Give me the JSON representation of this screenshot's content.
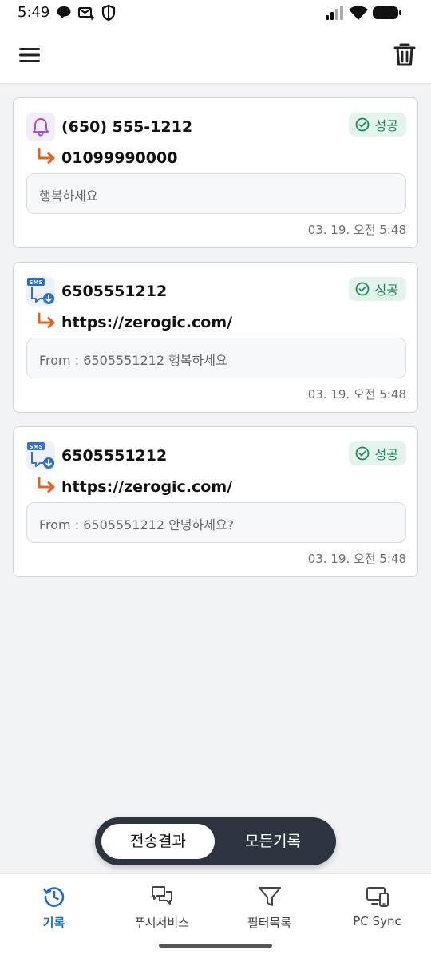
{
  "status_bar": {
    "time": "5:49"
  },
  "colors": {
    "accent": "#1c6fc4",
    "success": "#1f8a5b",
    "success_bg": "#e3f4ec",
    "arrow": "#e3601e",
    "segment_bg": "#2d333f"
  },
  "records": [
    {
      "icon": "bell-icon",
      "sender": "(650) 555-1212",
      "status": "성공",
      "target": "01099990000",
      "message": "행복하세요",
      "date": "03. 19. 오전 5:48"
    },
    {
      "icon": "sms-icon",
      "sender": "6505551212",
      "status": "성공",
      "target": "https://zerogic.com/",
      "message": "From : 6505551212 행복하세요",
      "date": "03. 19. 오전 5:48"
    },
    {
      "icon": "sms-icon",
      "sender": "6505551212",
      "status": "성공",
      "target": "https://zerogic.com/",
      "message": "From : 6505551212 안녕하세요?",
      "date": "03. 19. 오전 5:48"
    }
  ],
  "segment": {
    "selected": "전송결과",
    "other": "모든기록"
  },
  "bottom_nav": [
    {
      "label": "기록",
      "icon": "history-icon",
      "active": true
    },
    {
      "label": "푸시서비스",
      "icon": "chat-icon",
      "active": false
    },
    {
      "label": "필터목록",
      "icon": "filter-icon",
      "active": false
    },
    {
      "label": "PC Sync",
      "icon": "pc-sync-icon",
      "active": false
    }
  ]
}
